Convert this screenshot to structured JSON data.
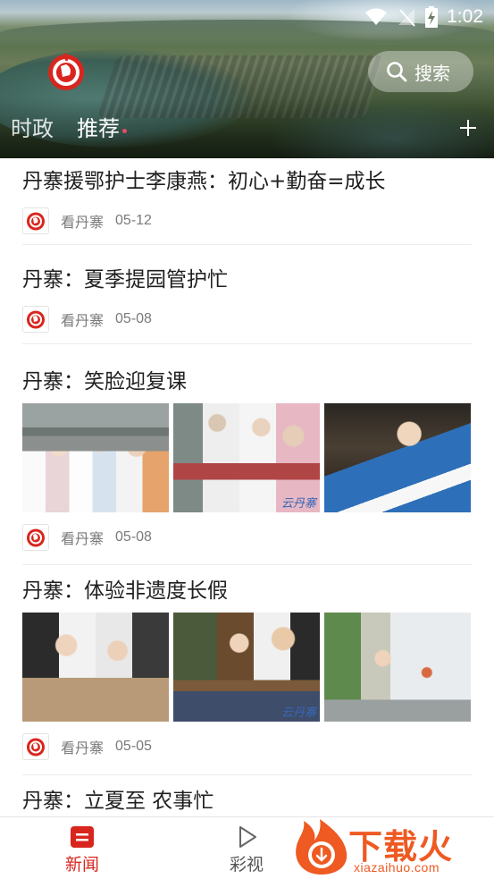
{
  "status_bar": {
    "time": "1:02"
  },
  "header": {
    "search_label": "搜索",
    "tabs": [
      {
        "label": "时政",
        "active": false
      },
      {
        "label": "推荐",
        "active": true
      }
    ]
  },
  "feed": {
    "items": [
      {
        "title": "丹寨援鄂护士李康燕：初心+勤奋=成长",
        "source": "看丹寨",
        "date": "05-12"
      },
      {
        "title": "丹寨：夏季提园管护忙",
        "source": "看丹寨",
        "date": "05-08"
      },
      {
        "title": "丹寨：笑脸迎复课",
        "source": "看丹寨",
        "date": "05-08",
        "image_watermark": "云丹寨"
      },
      {
        "title": "丹寨：体验非遗度长假",
        "source": "看丹寨",
        "date": "05-05",
        "image_watermark": "云丹寨"
      },
      {
        "title": "丹寨：立夏至 农事忙"
      }
    ]
  },
  "bottom_nav": {
    "items": [
      {
        "label": "新闻",
        "active": true
      },
      {
        "label": "彩视",
        "active": false
      }
    ]
  },
  "watermark_brand": {
    "name": "下载火",
    "url": "xiazaihuo.com"
  },
  "colors": {
    "accent": "#d8261f",
    "brand_orange": "#ee5a22",
    "meta_text": "#7a7a7a",
    "divider": "#ececec"
  }
}
